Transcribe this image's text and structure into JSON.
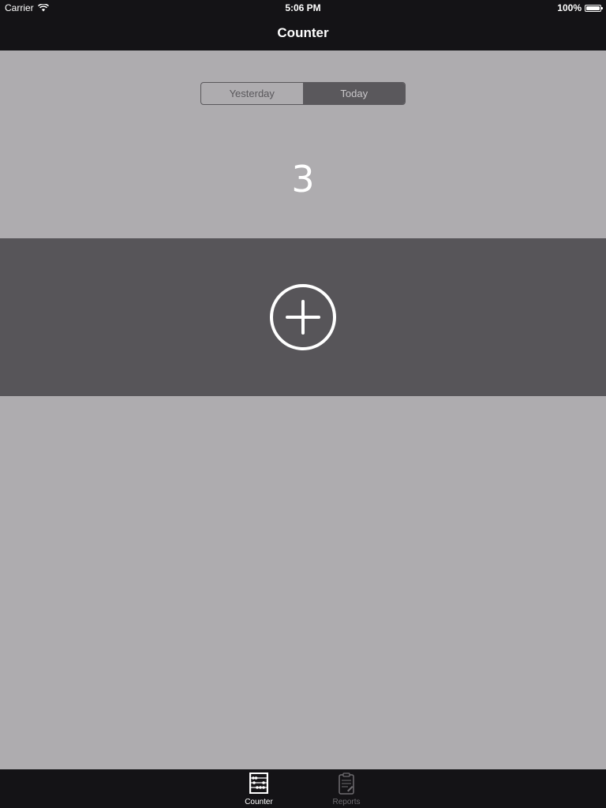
{
  "status_bar": {
    "carrier": "Carrier",
    "time": "5:06 PM",
    "battery": "100%"
  },
  "nav": {
    "title": "Counter"
  },
  "segments": {
    "items": [
      "Yesterday",
      "Today"
    ],
    "selected": "Today"
  },
  "counter": {
    "value": "3"
  },
  "tab_bar": {
    "items": [
      {
        "label": "Counter",
        "icon": "abacus-icon",
        "selected": true
      },
      {
        "label": "Reports",
        "icon": "clipboard-icon",
        "selected": false
      }
    ]
  },
  "colors": {
    "bars": "#141316",
    "background": "#aeacaf",
    "band": "#575559",
    "segment_selected": "#5a585c",
    "text_light": "#ffffff"
  }
}
